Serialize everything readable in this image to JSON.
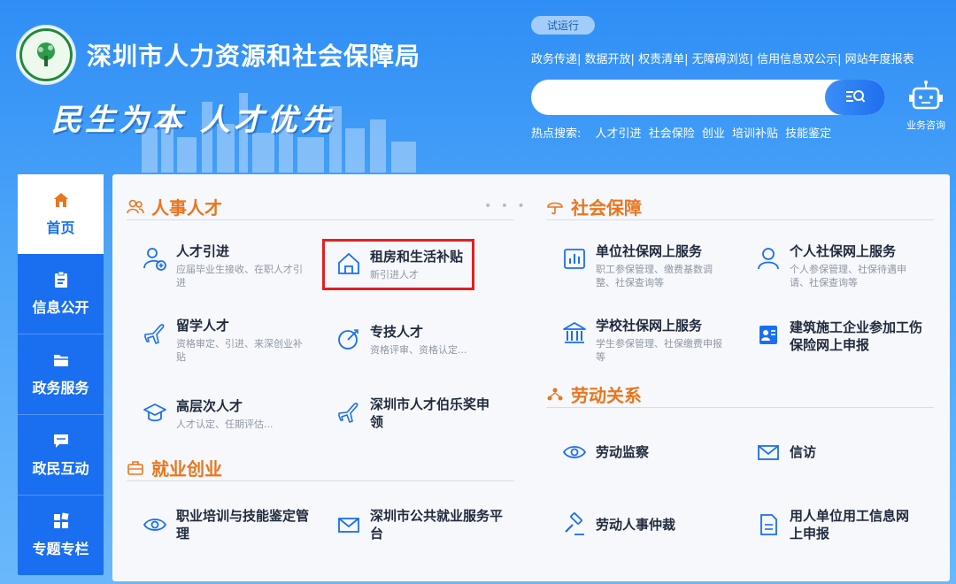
{
  "header": {
    "site_title": "深圳市人力资源和社会保障局",
    "slogan": "民生为本 人才优先",
    "trial_badge": "试运行",
    "top_links": [
      "政务传递",
      "数据开放",
      "权责清单",
      "无障碍浏览",
      "信用信息双公示",
      "网站年度报表"
    ],
    "search": {
      "placeholder": "",
      "button_icon": "search-icon"
    },
    "robot_label": "业务咨询",
    "hot_search": {
      "label": "热点搜索:",
      "keywords": [
        "人才引进",
        "社会保险",
        "创业",
        "培训补贴",
        "技能鉴定"
      ]
    }
  },
  "sidebar": {
    "items": [
      {
        "label": "首页",
        "icon": "home-icon",
        "active": true
      },
      {
        "label": "信息公开",
        "icon": "clipboard-icon",
        "active": false
      },
      {
        "label": "政务服务",
        "icon": "folder-icon",
        "active": false
      },
      {
        "label": "政民互动",
        "icon": "chat-icon",
        "active": false
      },
      {
        "label": "专题专栏",
        "icon": "grid-icon",
        "active": false
      }
    ]
  },
  "sections": {
    "talent": {
      "title": "人事人才",
      "more": "• • •",
      "items": [
        {
          "title": "人才引进",
          "desc": "应届毕业生接收、在职人才引进",
          "icon": "person-add-icon"
        },
        {
          "title": "租房和生活补贴",
          "desc": "新引进人才",
          "icon": "house-icon"
        },
        {
          "title": "留学人才",
          "desc": "资格审定、引进、来深创业补贴",
          "icon": "airplane-icon"
        },
        {
          "title": "专技人才",
          "desc": "资格评审、资格认定...",
          "icon": "target-icon"
        },
        {
          "title": "高层次人才",
          "desc": "人才认定、任期评估...",
          "icon": "graduation-cap-icon"
        },
        {
          "title": "深圳市人才伯乐奖申领",
          "desc": "",
          "icon": "airplane-icon"
        }
      ]
    },
    "employment": {
      "title": "就业创业",
      "items": [
        {
          "title": "职业培训与技能鉴定管理",
          "icon": "eye-icon"
        },
        {
          "title": "深圳市公共就业服务平台",
          "icon": "envelope-icon"
        }
      ]
    },
    "social": {
      "title": "社会保障",
      "items": [
        {
          "title": "单位社保网上服务",
          "desc": "职工参保管理、缴费基数调整、社保查询等",
          "icon": "building-chart-icon"
        },
        {
          "title": "个人社保网上服务",
          "desc": "个人参保管理、社保待遇申请、社保查询等",
          "icon": "person-icon"
        },
        {
          "title": "学校社保网上服务",
          "desc": "学生参保管理、社保缴费申报等",
          "icon": "school-icon"
        },
        {
          "title": "建筑施工企业参加工伤保险网上申报",
          "desc": "",
          "icon": "id-card-icon"
        }
      ]
    },
    "labor": {
      "title": "劳动关系",
      "items": [
        {
          "title": "劳动监察",
          "icon": "eye-icon"
        },
        {
          "title": "信访",
          "icon": "envelope-icon"
        },
        {
          "title": "劳动人事仲裁",
          "icon": "gavel-icon"
        },
        {
          "title": "用人单位用工信息网上申报",
          "icon": "document-icon"
        }
      ]
    }
  },
  "colors": {
    "primary": "#1a6ff0",
    "accent": "#e9761e",
    "highlight": "#e0211f"
  }
}
